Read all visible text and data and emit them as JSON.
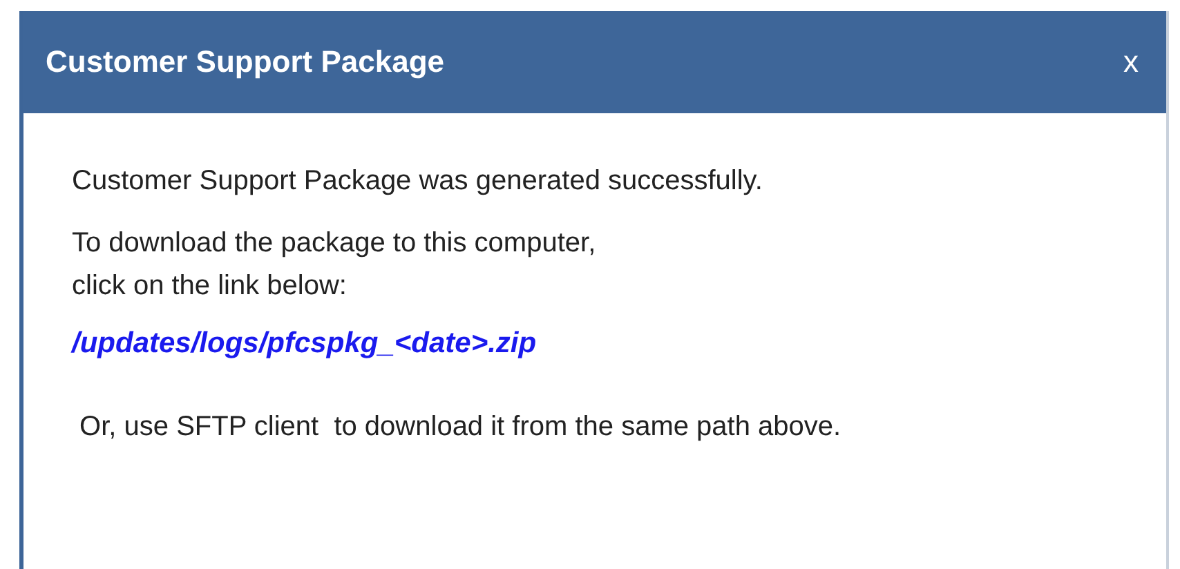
{
  "dialog": {
    "title": "Customer Support Package",
    "close": "x"
  },
  "body": {
    "message": "Customer Support Package was generated successfully.",
    "instructions": [
      "To download the package to this computer,",
      "click on the link below:"
    ],
    "link": "/updates/logs/pfcspkg_<date>.zip",
    "note": " Or, use SFTP client  to download it from the same path above."
  }
}
